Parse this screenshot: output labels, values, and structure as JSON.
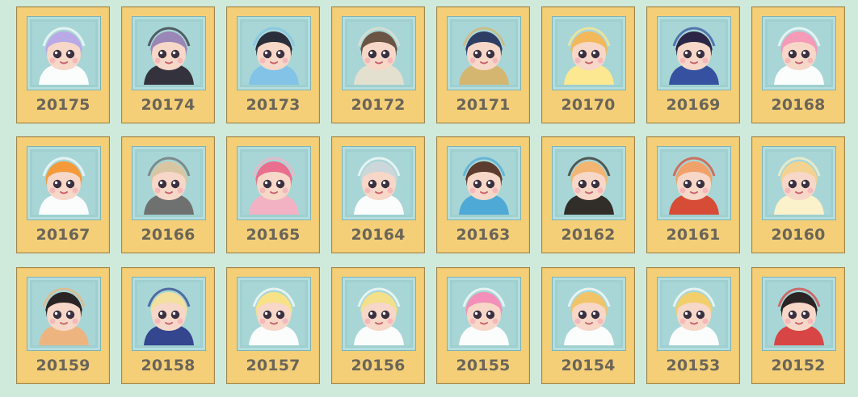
{
  "cards": [
    {
      "id": "20175",
      "icon": "character-portrait-icon",
      "hair": "#b9a9e6",
      "accent": "#ffffff"
    },
    {
      "id": "20174",
      "icon": "character-portrait-icon",
      "hair": "#9b86b8",
      "accent": "#2d2a35"
    },
    {
      "id": "20173",
      "icon": "character-portrait-icon",
      "hair": "#2a2d3a",
      "accent": "#7fc2e8"
    },
    {
      "id": "20172",
      "icon": "character-portrait-icon",
      "hair": "#6a5444",
      "accent": "#e7e0d0"
    },
    {
      "id": "20171",
      "icon": "character-portrait-icon",
      "hair": "#2e3d63",
      "accent": "#d7b46a"
    },
    {
      "id": "20170",
      "icon": "character-portrait-icon",
      "hair": "#f2b85a",
      "accent": "#ffe98c"
    },
    {
      "id": "20169",
      "icon": "character-portrait-icon",
      "hair": "#2b2645",
      "accent": "#2f4a9c"
    },
    {
      "id": "20168",
      "icon": "character-portrait-icon",
      "hair": "#f59ab7",
      "accent": "#ffffff"
    },
    {
      "id": "20167",
      "icon": "character-portrait-icon",
      "hair": "#f49a3a",
      "accent": "#ffffff"
    },
    {
      "id": "20166",
      "icon": "character-portrait-icon",
      "hair": "#d8c6a3",
      "accent": "#6b6b6b"
    },
    {
      "id": "20165",
      "icon": "character-portrait-icon",
      "hair": "#ea6e8e",
      "accent": "#f7b0c3"
    },
    {
      "id": "20164",
      "icon": "character-portrait-icon",
      "hair": "#cbd7db",
      "accent": "#ffffff"
    },
    {
      "id": "20163",
      "icon": "character-portrait-icon",
      "hair": "#5b3c2f",
      "accent": "#4aa7d6"
    },
    {
      "id": "20162",
      "icon": "character-portrait-icon",
      "hair": "#f3b572",
      "accent": "#2a2420"
    },
    {
      "id": "20161",
      "icon": "character-portrait-icon",
      "hair": "#f1a26a",
      "accent": "#d9452d"
    },
    {
      "id": "20160",
      "icon": "character-portrait-icon",
      "hair": "#f4d28f",
      "accent": "#fff2c9"
    },
    {
      "id": "20159",
      "icon": "character-portrait-icon",
      "hair": "#2a2425",
      "accent": "#f0b27a"
    },
    {
      "id": "20158",
      "icon": "character-portrait-icon",
      "hair": "#f3df9e",
      "accent": "#2c3e8a"
    },
    {
      "id": "20157",
      "icon": "character-portrait-icon",
      "hair": "#f7e287",
      "accent": "#ffffff"
    },
    {
      "id": "20156",
      "icon": "character-portrait-icon",
      "hair": "#f4e08a",
      "accent": "#ffffff"
    },
    {
      "id": "20155",
      "icon": "character-portrait-icon",
      "hair": "#f38fb8",
      "accent": "#ffffff"
    },
    {
      "id": "20154",
      "icon": "character-portrait-icon",
      "hair": "#f2c46a",
      "accent": "#ffffff"
    },
    {
      "id": "20153",
      "icon": "character-portrait-icon",
      "hair": "#f2cf6a",
      "accent": "#ffffff"
    },
    {
      "id": "20152",
      "icon": "character-portrait-icon",
      "hair": "#2a2425",
      "accent": "#d93d3d"
    }
  ]
}
